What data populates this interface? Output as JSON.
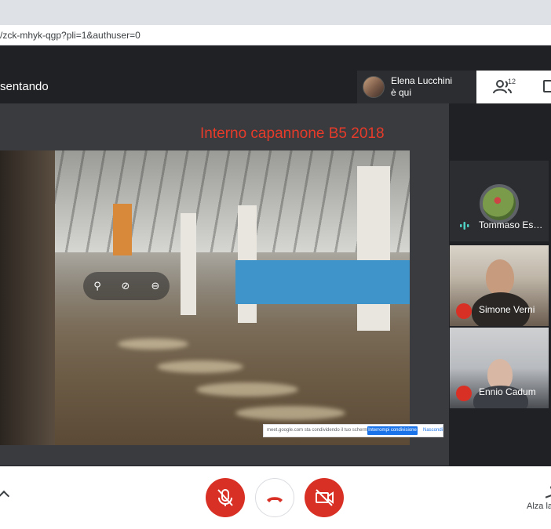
{
  "browser": {
    "url": "/zck-mhyk-qgp?pli=1&authuser=0"
  },
  "meet_header": {
    "presenting_label": "sentando",
    "joined_toast": {
      "line1": "Elena Lucchini",
      "line2": "è qui"
    },
    "people_count": "12"
  },
  "slide": {
    "title": "Interno  capannone B5 2018"
  },
  "share_bar": {
    "text": "meet.google.com sta condividendo il tuo schermo.",
    "stop_label": "Interrompi condivisione",
    "hide_label": "Nascondi"
  },
  "participants": [
    {
      "name": "Tommaso Es…",
      "state": "speaking"
    },
    {
      "name": "Simone Verni",
      "state": "muted"
    },
    {
      "name": "Ennio Cadum",
      "state": "muted"
    }
  ],
  "bottom_bar": {
    "raise_hand_label": "Alza la"
  },
  "colors": {
    "accent_red": "#d93025",
    "slide_title": "#e63b2a",
    "google_blue": "#1a73e8"
  }
}
